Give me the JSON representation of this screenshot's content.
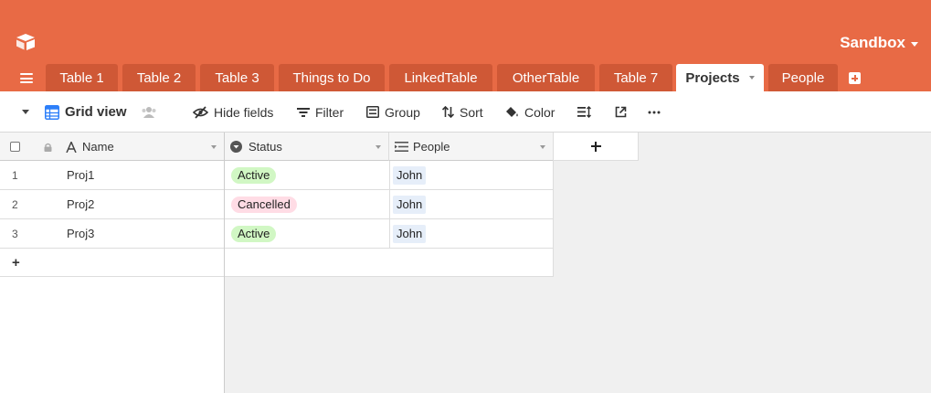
{
  "header": {
    "base_name": "Sandbox",
    "bg_color": "#e86a45",
    "tabs": [
      {
        "label": "Table 1"
      },
      {
        "label": "Table 2"
      },
      {
        "label": "Table 3"
      },
      {
        "label": "Things to Do"
      },
      {
        "label": "LinkedTable"
      },
      {
        "label": "OtherTable"
      },
      {
        "label": "Table 7"
      },
      {
        "label": "Projects",
        "active": true
      },
      {
        "label": "People"
      }
    ]
  },
  "toolbar": {
    "view_name": "Grid view",
    "hide_fields": "Hide fields",
    "filter": "Filter",
    "group": "Group",
    "sort": "Sort",
    "color": "Color"
  },
  "grid": {
    "columns": [
      {
        "name": "Name",
        "icon": "text-field-icon"
      },
      {
        "name": "Status",
        "icon": "single-select-icon"
      },
      {
        "name": "People",
        "icon": "linked-record-icon"
      }
    ],
    "rows": [
      {
        "num": "1",
        "name": "Proj1",
        "status": "Active",
        "people": "John"
      },
      {
        "num": "2",
        "name": "Proj2",
        "status": "Cancelled",
        "people": "John"
      },
      {
        "num": "3",
        "name": "Proj3",
        "status": "Active",
        "people": "John"
      }
    ],
    "add_row": "+",
    "status_colors": {
      "Active": "#d1f7c4",
      "Cancelled": "#ffdce5"
    }
  }
}
